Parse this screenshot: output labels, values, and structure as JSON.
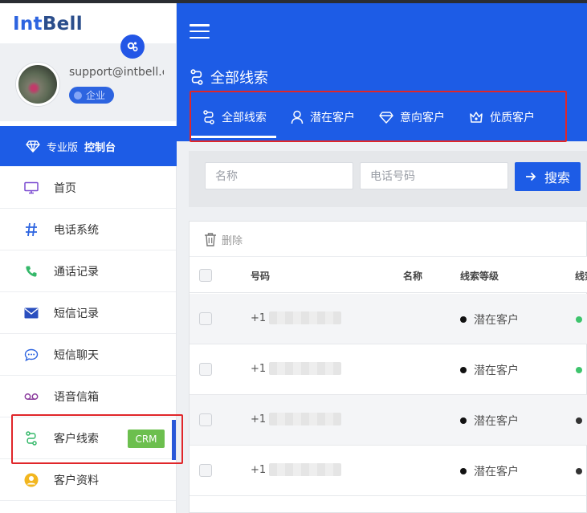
{
  "brand": {
    "part1": "Int",
    "part2": "Bell"
  },
  "profile": {
    "email": "support@intbell.com",
    "badge": "企业"
  },
  "console": {
    "edition": "专业版",
    "label": "控制台"
  },
  "nav": {
    "items": [
      {
        "label": "首页",
        "icon": "monitor-icon"
      },
      {
        "label": "电话系统",
        "icon": "hash-icon"
      },
      {
        "label": "通话记录",
        "icon": "phone-icon"
      },
      {
        "label": "短信记录",
        "icon": "envelope-icon"
      },
      {
        "label": "短信聊天",
        "icon": "chat-bubble-icon"
      },
      {
        "label": "语音信箱",
        "icon": "voicemail-icon"
      },
      {
        "label": "客户线索",
        "icon": "route-icon",
        "tag": "CRM",
        "active": true
      },
      {
        "label": "客户资料",
        "icon": "user-circle-icon"
      }
    ]
  },
  "header": {
    "page_title": "全部线索"
  },
  "tabs": [
    {
      "label": "全部线索",
      "icon": "route-icon",
      "active": true
    },
    {
      "label": "潜在客户",
      "icon": "user-icon"
    },
    {
      "label": "意向客户",
      "icon": "diamond-icon"
    },
    {
      "label": "优质客户",
      "icon": "crown-icon"
    }
  ],
  "search": {
    "name_placeholder": "名称",
    "phone_placeholder": "电话号码",
    "button": "搜索"
  },
  "table": {
    "delete_label": "删除",
    "columns": [
      "号码",
      "名称",
      "线索等级",
      "线索"
    ],
    "rows": [
      {
        "phone_prefix": "+1",
        "name": "",
        "level": "潜在客户",
        "status_color": "#3ec46d"
      },
      {
        "phone_prefix": "+1",
        "name": "",
        "level": "潜在客户",
        "status_color": "#3ec46d"
      },
      {
        "phone_prefix": "+1",
        "name": "",
        "level": "潜在客户",
        "status_color": "#333333"
      },
      {
        "phone_prefix": "+1",
        "name": "",
        "level": "潜在客户",
        "status_color": "#333333"
      }
    ]
  },
  "colors": {
    "primary": "#1d5ce6",
    "crm_tag": "#6cbf4e",
    "highlight_border": "#e0262a"
  }
}
